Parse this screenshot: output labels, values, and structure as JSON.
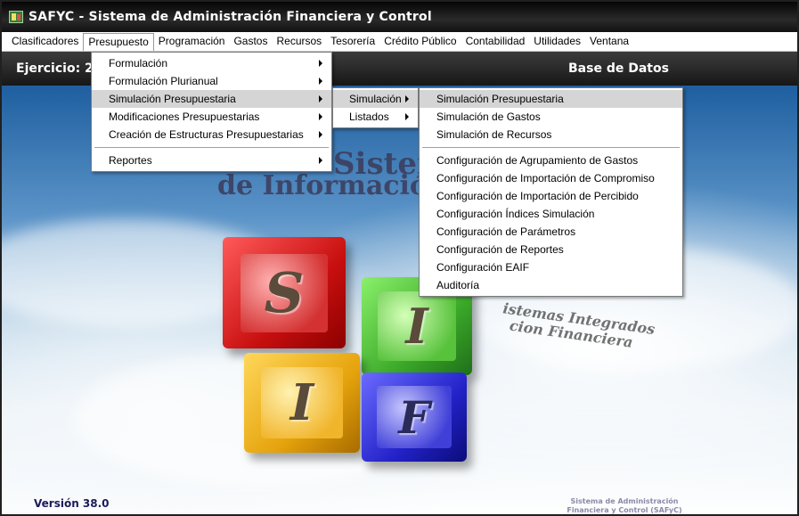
{
  "window": {
    "title": "SAFYC - Sistema de Administración Financiera y Control",
    "app_icon": "safyc-app-icon"
  },
  "menubar": {
    "items": [
      {
        "label": "Clasificadores"
      },
      {
        "label": "Presupuesto"
      },
      {
        "label": "Programación"
      },
      {
        "label": "Gastos"
      },
      {
        "label": "Recursos"
      },
      {
        "label": "Tesorería"
      },
      {
        "label": "Crédito Público"
      },
      {
        "label": "Contabilidad"
      },
      {
        "label": "Utilidades"
      },
      {
        "label": "Ventana"
      }
    ],
    "active": "Presupuesto"
  },
  "header": {
    "ejercicio_label": "Ejercicio: 2",
    "base_datos_label": "Base de Datos"
  },
  "menus": {
    "presupuesto": [
      {
        "label": "Formulación",
        "submenu": true
      },
      {
        "label": "Formulación Plurianual",
        "submenu": true
      },
      {
        "label": "Simulación Presupuestaria",
        "submenu": true,
        "highlighted": true
      },
      {
        "label": "Modificaciones Presupuestarias",
        "submenu": true
      },
      {
        "label": "Creación de Estructuras Presupuestarias",
        "submenu": true
      },
      {
        "separator": true
      },
      {
        "label": "Reportes",
        "submenu": true
      }
    ],
    "simulacion": [
      {
        "label": "Simulación",
        "submenu": true,
        "highlighted": true
      },
      {
        "label": "Listados",
        "submenu": true
      }
    ],
    "simulacion_sub": [
      {
        "label": "Simulación Presupuestaria",
        "highlighted": true
      },
      {
        "label": "Simulación de Gastos"
      },
      {
        "label": "Simulación de Recursos"
      },
      {
        "separator": true
      },
      {
        "label": "Configuración de Agrupamiento de Gastos"
      },
      {
        "label": "Configuración de Importación de Compromiso"
      },
      {
        "label": "Configuración de Importación de Percibido"
      },
      {
        "label": "Configuración Índices Simulación"
      },
      {
        "label": "Configuración de Parámetros"
      },
      {
        "label": "Configuración de Reportes"
      },
      {
        "label": "Configuración EAIF"
      },
      {
        "label": "Auditoría"
      }
    ]
  },
  "splash": {
    "title_line1": "Sistem",
    "title_line2": "de Informació",
    "slogan_line1": "istemas Integrados",
    "slogan_line2": "cion Financiera",
    "cube_letters": [
      "S",
      "I",
      "I",
      "F"
    ],
    "version": "Versión 38.0",
    "footer_line1": "Sistema de Administración",
    "footer_line2": "Financiera y Control (SAFyC)"
  }
}
